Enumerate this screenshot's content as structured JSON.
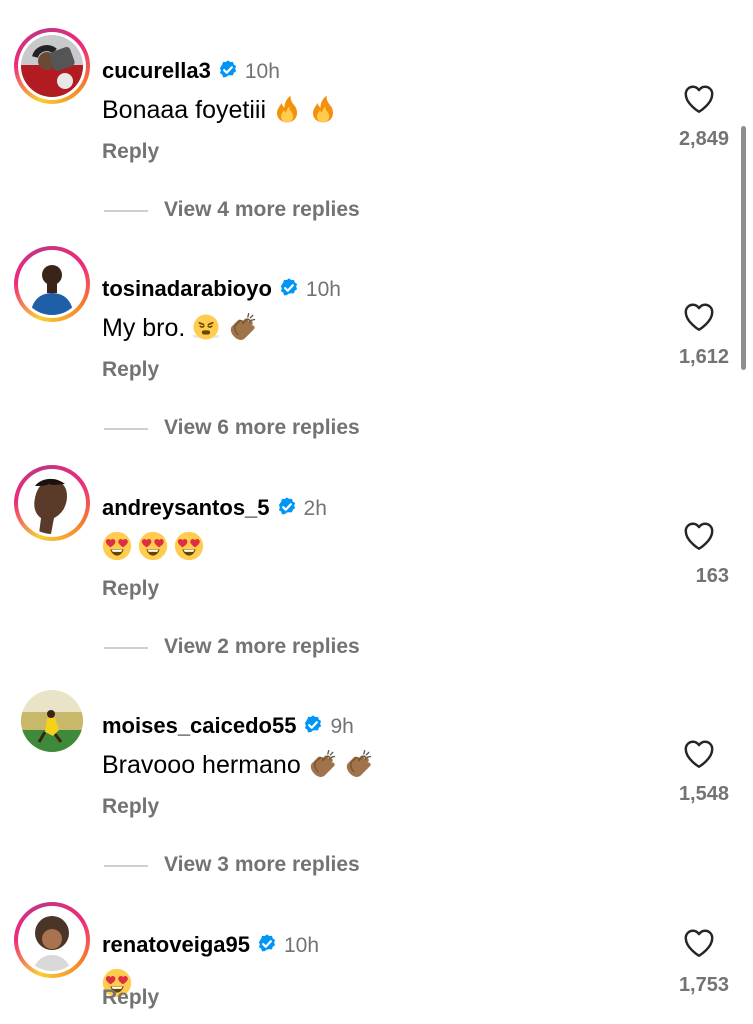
{
  "comments": [
    {
      "username": "cucurella3",
      "time": "10h",
      "text": "Bonaaa foyetiii",
      "emojis": [
        "fire",
        "fire"
      ],
      "reply": "Reply",
      "likes": "2,849",
      "view_more": "View 4 more replies"
    },
    {
      "username": "tosinadarabioyo",
      "time": "10h",
      "text": "My bro.",
      "emojis": [
        "face-with-steam",
        "clapping-hands"
      ],
      "reply": "Reply",
      "likes": "1,612",
      "view_more": "View 6 more replies"
    },
    {
      "username": "andreysantos_5",
      "time": "2h",
      "text": "",
      "emojis": [
        "heart-eyes",
        "heart-eyes",
        "heart-eyes"
      ],
      "reply": "Reply",
      "likes": "163",
      "view_more": "View 2 more replies"
    },
    {
      "username": "moises_caicedo55",
      "time": "9h",
      "text": "Bravooo hermano",
      "emojis": [
        "clapping-hands",
        "clapping-hands"
      ],
      "reply": "Reply",
      "likes": "1,548",
      "view_more": "View 3 more replies"
    },
    {
      "username": "renatoveiga95",
      "time": "10h",
      "text": "",
      "emojis": [
        "heart-eyes"
      ],
      "reply": "Reply",
      "likes": "1,753",
      "view_more": ""
    }
  ],
  "colors": {
    "secondary_text": "#737373",
    "verified_blue": "#0095f6"
  }
}
